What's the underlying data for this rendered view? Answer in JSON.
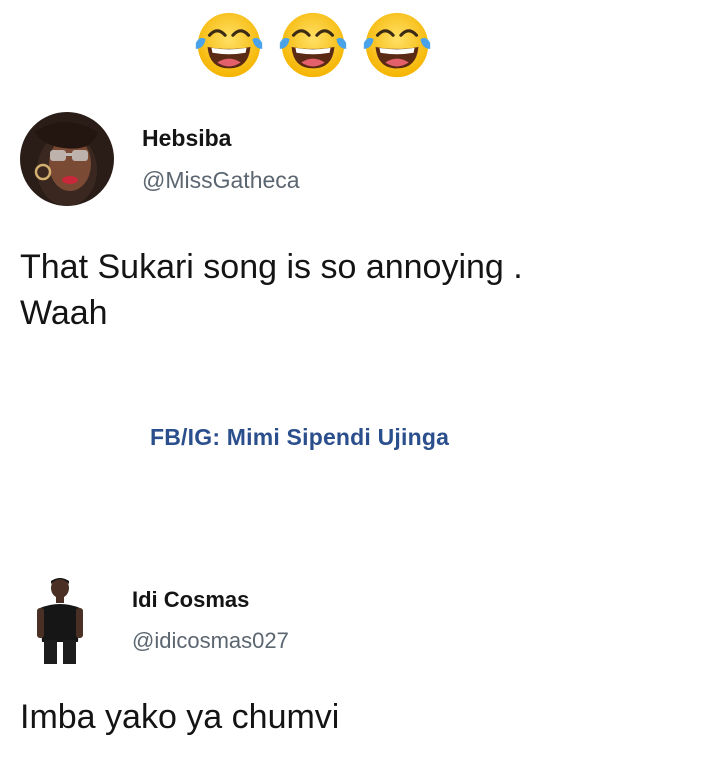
{
  "reaction": {
    "emoji_icons": [
      "tears-of-joy-icon",
      "tears-of-joy-icon",
      "tears-of-joy-icon"
    ]
  },
  "tweet": {
    "display_name": "Hebsiba",
    "handle": "@MissGatheca",
    "text": "That Sukari song is so annoying .\nWaah"
  },
  "watermark": "FB/IG: Mimi Sipendi Ujinga",
  "reply": {
    "display_name": "Idi Cosmas",
    "handle": "@idicosmas027",
    "text": "Imba yako ya chumvi"
  },
  "colors": {
    "text": "#141414",
    "handle": "#5b6670",
    "watermark": "#2b4f8c",
    "emoji_face": "#ffcc33",
    "tears": "#4aa3e8"
  }
}
